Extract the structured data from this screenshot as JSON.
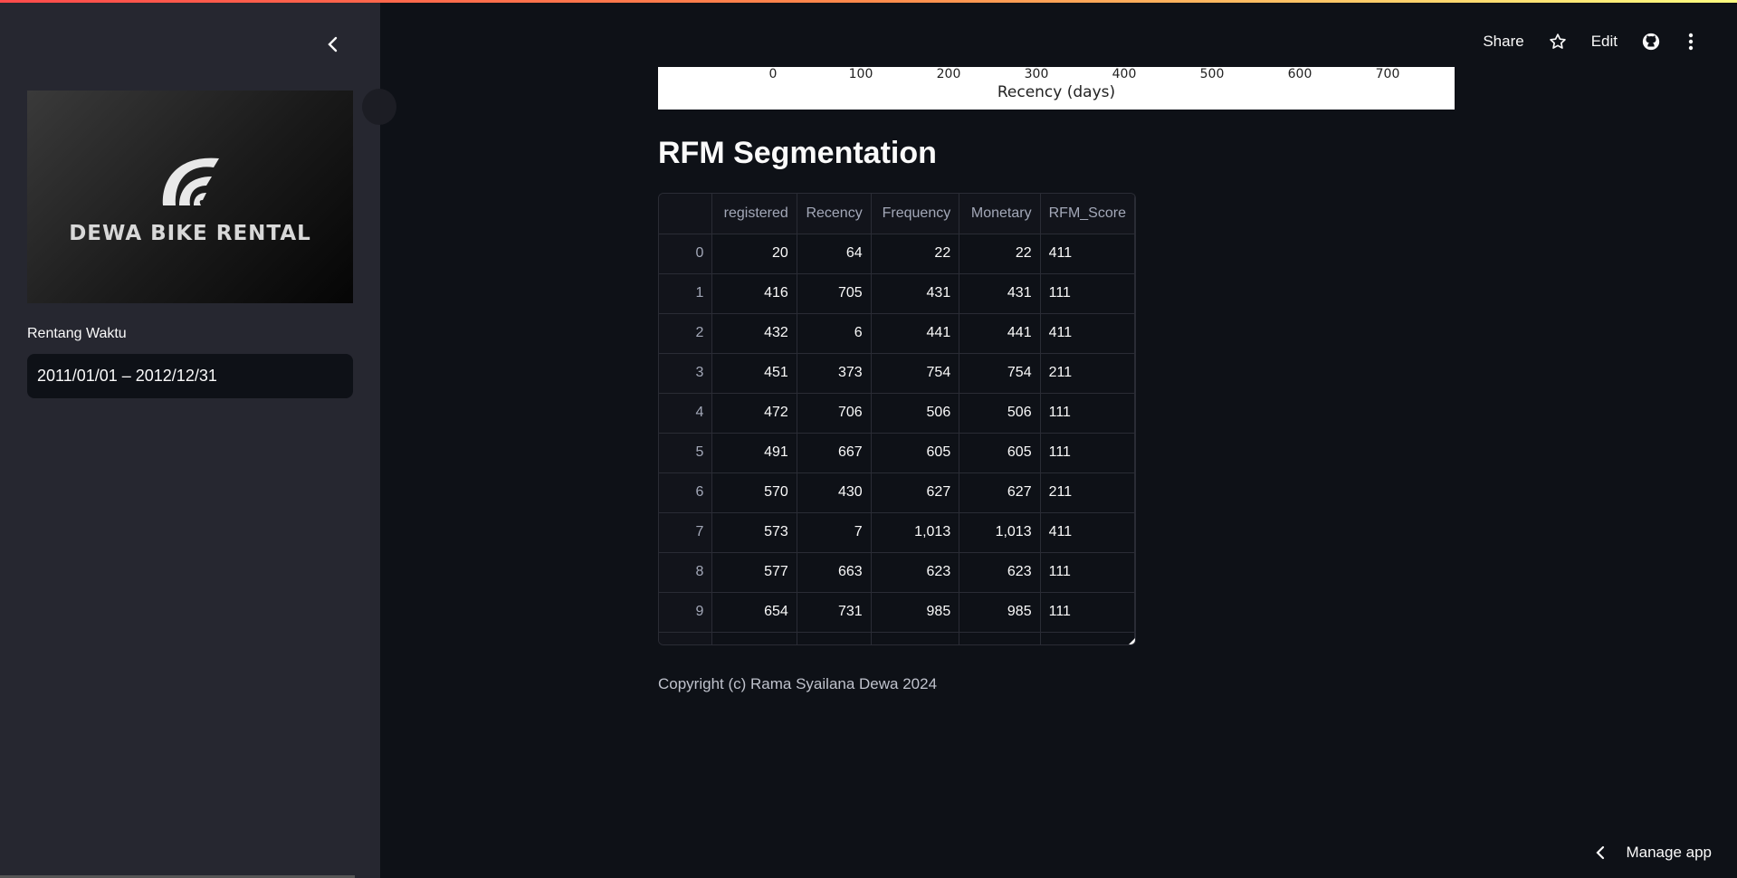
{
  "header": {
    "share_label": "Share",
    "edit_label": "Edit",
    "icons": [
      "star-icon",
      "github-icon",
      "more-vertical-icon"
    ]
  },
  "sidebar": {
    "logo_text": "DEWA BIKE RENTAL",
    "date_label": "Rentang Waktu",
    "date_value": "2011/01/01 – 2012/12/31"
  },
  "chart_tail": {
    "x_ticks": [
      "0",
      "100",
      "200",
      "300",
      "400",
      "500",
      "600",
      "700"
    ],
    "xlabel": "Recency (days)"
  },
  "main": {
    "section_title": "RFM Segmentation",
    "table": {
      "columns": [
        "",
        "registered",
        "Recency",
        "Frequency",
        "Monetary",
        "RFM_Score"
      ],
      "rows": [
        [
          "0",
          "20",
          "64",
          "22",
          "22",
          "411"
        ],
        [
          "1",
          "416",
          "705",
          "431",
          "431",
          "111"
        ],
        [
          "2",
          "432",
          "6",
          "441",
          "441",
          "411"
        ],
        [
          "3",
          "451",
          "373",
          "754",
          "754",
          "211"
        ],
        [
          "4",
          "472",
          "706",
          "506",
          "506",
          "111"
        ],
        [
          "5",
          "491",
          "667",
          "605",
          "605",
          "111"
        ],
        [
          "6",
          "570",
          "430",
          "627",
          "627",
          "211"
        ],
        [
          "7",
          "573",
          "7",
          "1,013",
          "1,013",
          "411"
        ],
        [
          "8",
          "577",
          "663",
          "623",
          "623",
          "111"
        ],
        [
          "9",
          "654",
          "731",
          "985",
          "985",
          "111"
        ]
      ]
    },
    "copyright": "Copyright (c) Rama Syailana Dewa 2024"
  },
  "footer": {
    "manage_app_label": "Manage app"
  }
}
